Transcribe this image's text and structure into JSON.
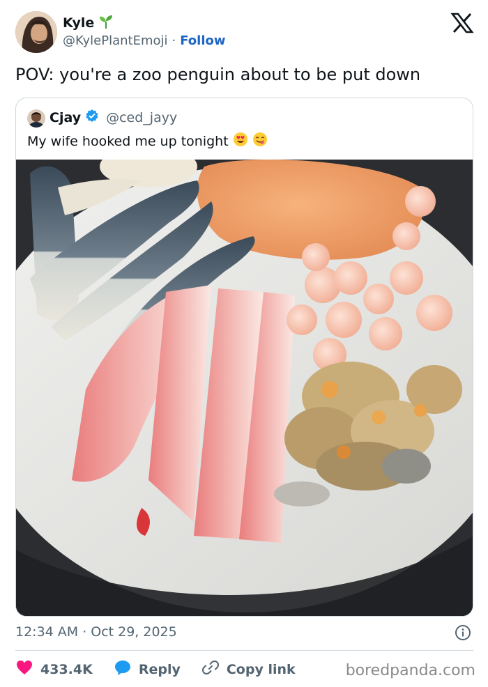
{
  "author": {
    "name": "Kyle",
    "handle": "@KylePlantEmoji",
    "separator": "·",
    "follow_label": "Follow",
    "badge_icon": "seedling-icon"
  },
  "tweet": {
    "text": "POV: you're a zoo penguin about to be put down"
  },
  "quoted": {
    "name": "Cjay",
    "handle": "@ced_jayy",
    "verified_icon": "verified-badge-icon",
    "text": "My wife hooked me up tonight",
    "emojis": [
      "heart-eyes-emoji",
      "yum-face-emoji"
    ],
    "photo": "plate-of-raw-seafood-image"
  },
  "meta": {
    "time": "12:34 AM",
    "separator": "·",
    "date": "Oct 29, 2025"
  },
  "actions": {
    "likes": "433.4K",
    "reply_label": "Reply",
    "copy_label": "Copy link"
  },
  "watermark": "boredpanda.com",
  "colors": {
    "link": "#1d66c4",
    "heart": "#f91880",
    "reply": "#1d9bf0",
    "muted": "#536471"
  }
}
